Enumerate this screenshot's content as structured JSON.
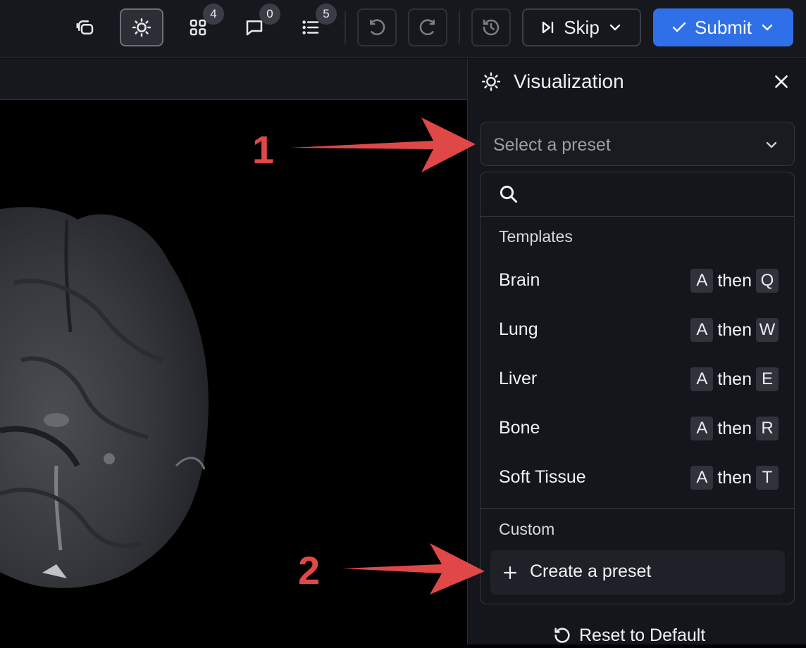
{
  "toolbar": {
    "layers_icon": "layers-icon",
    "brightness_icon": "sun-icon",
    "annotations_count": "4",
    "comments_count": "0",
    "list_count": "5",
    "skip_label": "Skip",
    "submit_label": "Submit"
  },
  "panel": {
    "title": "Visualization",
    "preset_placeholder": "Select a preset",
    "search_placeholder": "",
    "templates_label": "Templates",
    "templates": [
      {
        "label": "Brain",
        "key1": "A",
        "then": "then",
        "key2": "Q"
      },
      {
        "label": "Lung",
        "key1": "A",
        "then": "then",
        "key2": "W"
      },
      {
        "label": "Liver",
        "key1": "A",
        "then": "then",
        "key2": "E"
      },
      {
        "label": "Bone",
        "key1": "A",
        "then": "then",
        "key2": "R"
      },
      {
        "label": "Soft Tissue",
        "key1": "A",
        "then": "then",
        "key2": "T"
      }
    ],
    "custom_label": "Custom",
    "create_label": "Create a preset",
    "reset_label": "Reset to Default"
  },
  "annotations": {
    "step1": "1",
    "step2": "2"
  },
  "colors": {
    "accent": "#2f6fe8",
    "annotation": "#e04848",
    "panel_bg": "#14161b"
  }
}
